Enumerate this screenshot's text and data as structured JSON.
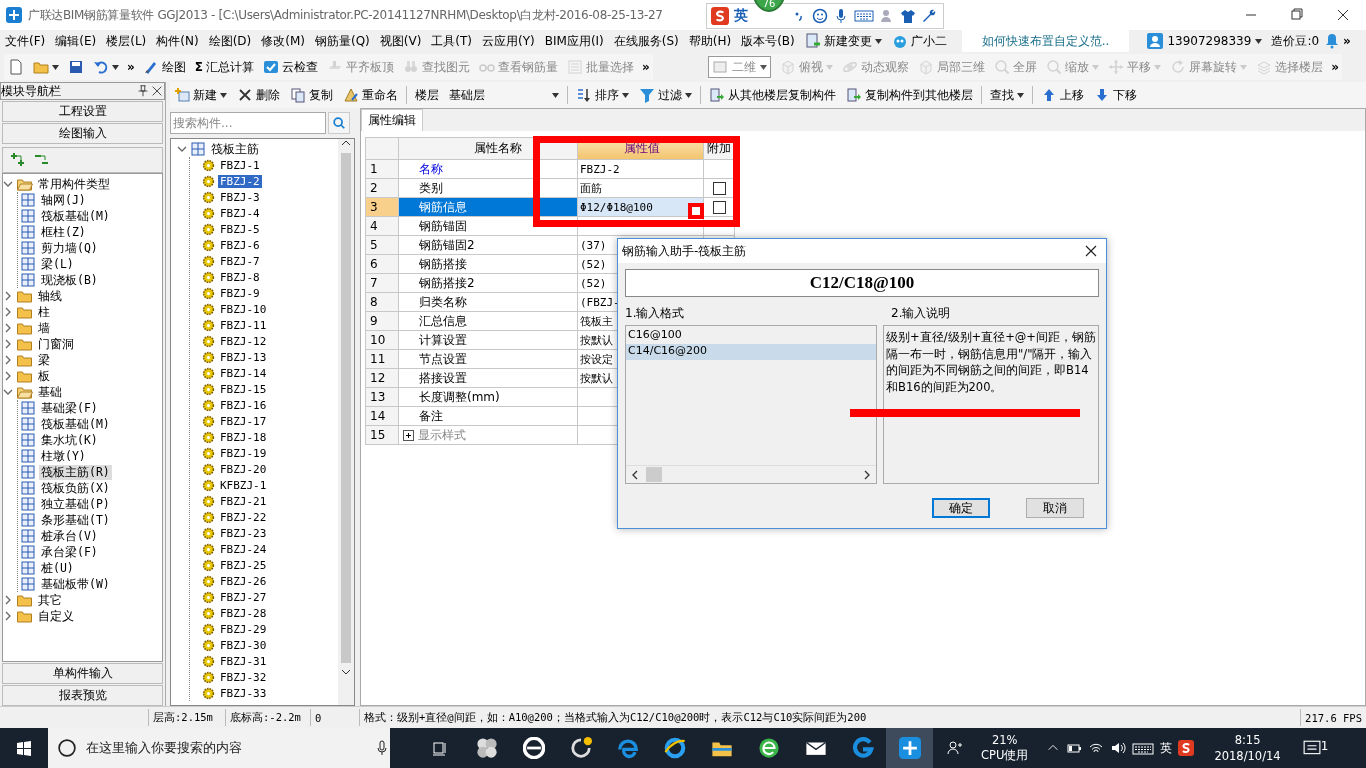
{
  "window": {
    "title": "广联达BIM钢筋算量软件 GGJ2013 - [C:\\Users\\Administrator.PC-20141127NRHM\\Desktop\\白龙村-2016-08-25-13-27"
  },
  "float_badge": {
    "text": "76"
  },
  "ime_bar": {
    "mode": "英"
  },
  "menu": [
    {
      "label": "文件(F)"
    },
    {
      "label": "编辑(E)"
    },
    {
      "label": "楼层(L)"
    },
    {
      "label": "构件(N)"
    },
    {
      "label": "绘图(D)"
    },
    {
      "label": "修改(M)"
    },
    {
      "label": "钢筋量(Q)"
    },
    {
      "label": "视图(V)"
    },
    {
      "label": "工具(T)"
    },
    {
      "label": "云应用(Y)"
    },
    {
      "label": "BIM应用(I)"
    },
    {
      "label": "在线服务(S)"
    },
    {
      "label": "帮助(H)"
    },
    {
      "label": "版本号(B)"
    }
  ],
  "menu_extras": {
    "change": {
      "label": "新建变更"
    },
    "assistant": {
      "label": "广小二"
    },
    "tip": {
      "text": "如何快速布置自定义范.."
    },
    "account": {
      "phone": "13907298339"
    },
    "beans": {
      "text": "造价豆:0"
    },
    "overflow": {
      "label": "»"
    }
  },
  "toolbars": [
    {
      "items": [
        {
          "kind": "icon",
          "dropdown": false,
          "disabled": false
        },
        {
          "kind": "icon",
          "dropdown": true,
          "disabled": false
        },
        {
          "kind": "icon",
          "dropdown": false,
          "disabled": false
        },
        {
          "kind": "icon",
          "dropdown": true,
          "disabled": false
        },
        {
          "kind": "overflow",
          "label": "»",
          "disabled": false
        },
        {
          "kind": "button",
          "label": "绘图",
          "dropdown": false,
          "disabled": false
        },
        {
          "kind": "button",
          "prefix": "Σ",
          "label": "汇总计算",
          "dropdown": false,
          "disabled": false
        },
        {
          "kind": "button",
          "label": "云检查",
          "dropdown": false,
          "disabled": false
        },
        {
          "kind": "button",
          "label": "平齐板顶",
          "dropdown": false,
          "disabled": true
        },
        {
          "kind": "button",
          "label": "查找图元",
          "dropdown": false,
          "disabled": true
        },
        {
          "kind": "button",
          "label": "查看钢筋量",
          "dropdown": false,
          "disabled": true
        },
        {
          "kind": "button",
          "label": "批量选择",
          "dropdown": false,
          "disabled": true
        },
        {
          "kind": "overflow",
          "label": "»",
          "disabled": false
        }
      ]
    },
    {
      "items": [
        {
          "kind": "combo",
          "label": "二维",
          "disabled": true
        },
        {
          "kind": "button",
          "label": "俯视",
          "dropdown": true,
          "disabled": true
        },
        {
          "kind": "button",
          "label": "动态观察",
          "dropdown": false,
          "disabled": true
        },
        {
          "kind": "button",
          "label": "局部三维",
          "dropdown": false,
          "disabled": true
        },
        {
          "kind": "button",
          "label": "全屏",
          "dropdown": false,
          "disabled": true
        },
        {
          "kind": "button",
          "label": "缩放",
          "dropdown": true,
          "disabled": true
        },
        {
          "kind": "button",
          "label": "平移",
          "dropdown": true,
          "disabled": true
        },
        {
          "kind": "button",
          "label": "屏幕旋转",
          "dropdown": true,
          "disabled": true
        },
        {
          "kind": "button",
          "label": "选择楼层",
          "dropdown": false,
          "disabled": true
        },
        {
          "kind": "overflow",
          "label": "»",
          "disabled": false
        }
      ]
    }
  ],
  "component_toolbar": [
    {
      "kind": "button",
      "label": "新建",
      "dropdown": true
    },
    {
      "kind": "button",
      "label": "删除",
      "dropdown": false
    },
    {
      "kind": "button",
      "label": "复制",
      "dropdown": false
    },
    {
      "kind": "button",
      "label": "重命名",
      "dropdown": false
    },
    {
      "kind": "label",
      "label": "楼层"
    },
    {
      "kind": "combo",
      "label": "基础层"
    },
    {
      "kind": "button",
      "label": "排序",
      "dropdown": true
    },
    {
      "kind": "button",
      "label": "过滤",
      "dropdown": true
    },
    {
      "kind": "button",
      "label": "从其他楼层复制构件",
      "dropdown": false
    },
    {
      "kind": "button",
      "label": "复制构件到其他楼层",
      "dropdown": false
    },
    {
      "kind": "text",
      "label": "查找",
      "dropdown": true
    },
    {
      "kind": "button",
      "label": "上移",
      "dropdown": false
    },
    {
      "kind": "button",
      "label": "下移",
      "dropdown": false
    }
  ],
  "nav": {
    "title": "模块导航栏",
    "top_buttons": [
      {
        "label": "工程设置"
      },
      {
        "label": "绘图输入"
      }
    ],
    "tree": [
      {
        "label": "常用构件类型",
        "expanded": true,
        "selected": false,
        "children": [
          {
            "label": "轴网(J)",
            "selected": false
          },
          {
            "label": "筏板基础(M)",
            "selected": false
          },
          {
            "label": "框柱(Z)",
            "selected": false
          },
          {
            "label": "剪力墙(Q)",
            "selected": false
          },
          {
            "label": "梁(L)",
            "selected": false
          },
          {
            "label": "现浇板(B)",
            "selected": false
          }
        ]
      },
      {
        "label": "轴线",
        "expanded": false,
        "selected": false
      },
      {
        "label": "柱",
        "expanded": false,
        "selected": false
      },
      {
        "label": "墙",
        "expanded": false,
        "selected": false
      },
      {
        "label": "门窗洞",
        "expanded": false,
        "selected": false
      },
      {
        "label": "梁",
        "expanded": false,
        "selected": false
      },
      {
        "label": "板",
        "expanded": false,
        "selected": false
      },
      {
        "label": "基础",
        "expanded": true,
        "selected": false,
        "children": [
          {
            "label": "基础梁(F)",
            "selected": false
          },
          {
            "label": "筏板基础(M)",
            "selected": false
          },
          {
            "label": "集水坑(K)",
            "selected": false
          },
          {
            "label": "柱墩(Y)",
            "selected": false
          },
          {
            "label": "筏板主筋(R)",
            "selected": true
          },
          {
            "label": "筏板负筋(X)",
            "selected": false
          },
          {
            "label": "独立基础(P)",
            "selected": false
          },
          {
            "label": "条形基础(T)",
            "selected": false
          },
          {
            "label": "桩承台(V)",
            "selected": false
          },
          {
            "label": "承台梁(F)",
            "selected": false
          },
          {
            "label": "桩(U)",
            "selected": false
          },
          {
            "label": "基础板带(W)",
            "selected": false
          }
        ]
      },
      {
        "label": "其它",
        "expanded": false,
        "selected": false
      },
      {
        "label": "自定义",
        "expanded": false,
        "selected": false
      }
    ],
    "bottom_buttons": [
      {
        "label": "单构件输入"
      },
      {
        "label": "报表预览"
      }
    ]
  },
  "components": {
    "search": {
      "placeholder": "搜索构件..."
    },
    "root": {
      "label": "筏板主筋",
      "expanded": true,
      "selected": false,
      "children": [
        {
          "label": "FBZJ-1",
          "selected": false
        },
        {
          "label": "FBZJ-2",
          "selected": true
        },
        {
          "label": "FBZJ-3",
          "selected": false
        },
        {
          "label": "FBZJ-4",
          "selected": false
        },
        {
          "label": "FBZJ-5",
          "selected": false
        },
        {
          "label": "FBZJ-6",
          "selected": false
        },
        {
          "label": "FBZJ-7",
          "selected": false
        },
        {
          "label": "FBZJ-8",
          "selected": false
        },
        {
          "label": "FBZJ-9",
          "selected": false
        },
        {
          "label": "FBZJ-10",
          "selected": false
        },
        {
          "label": "FBZJ-11",
          "selected": false
        },
        {
          "label": "FBZJ-12",
          "selected": false
        },
        {
          "label": "FBZJ-13",
          "selected": false
        },
        {
          "label": "FBZJ-14",
          "selected": false
        },
        {
          "label": "FBZJ-15",
          "selected": false
        },
        {
          "label": "FBZJ-16",
          "selected": false
        },
        {
          "label": "FBZJ-17",
          "selected": false
        },
        {
          "label": "FBZJ-18",
          "selected": false
        },
        {
          "label": "FBZJ-19",
          "selected": false
        },
        {
          "label": "FBZJ-20",
          "selected": false
        },
        {
          "label": "KFBZJ-1",
          "selected": false
        },
        {
          "label": "FBZJ-21",
          "selected": false
        },
        {
          "label": "FBZJ-22",
          "selected": false
        },
        {
          "label": "FBZJ-23",
          "selected": false
        },
        {
          "label": "FBZJ-24",
          "selected": false
        },
        {
          "label": "FBZJ-25",
          "selected": false
        },
        {
          "label": "FBZJ-26",
          "selected": false
        },
        {
          "label": "FBZJ-27",
          "selected": false
        },
        {
          "label": "FBZJ-28",
          "selected": false
        },
        {
          "label": "FBZJ-29",
          "selected": false
        },
        {
          "label": "FBZJ-30",
          "selected": false
        },
        {
          "label": "FBZJ-31",
          "selected": false
        },
        {
          "label": "FBZJ-32",
          "selected": false
        },
        {
          "label": "FBZJ-33",
          "selected": false
        }
      ]
    }
  },
  "properties": {
    "tab": {
      "label": "属性编辑",
      "selected": true
    },
    "columns": [
      "属性名称",
      "属性值",
      "附加"
    ],
    "rows": [
      {
        "num": "1",
        "name": "名称",
        "kind": "link",
        "value": "FBZJ-2",
        "selected": false
      },
      {
        "num": "2",
        "name": "类别",
        "kind": "normal",
        "value": "面筋",
        "selected": false,
        "checkbox": {
          "checked": false
        }
      },
      {
        "num": "3",
        "name": "钢筋信息",
        "kind": "normal",
        "value": "Φ12/Φ18@100",
        "selected": true,
        "checkbox": {
          "checked": false
        }
      },
      {
        "num": "4",
        "name": "钢筋锚固",
        "kind": "normal",
        "selected": false
      },
      {
        "num": "5",
        "name": "钢筋锚固2",
        "kind": "normal",
        "value": "(37)",
        "selected": false
      },
      {
        "num": "6",
        "name": "钢筋搭接",
        "kind": "normal",
        "value": "(52)",
        "selected": false
      },
      {
        "num": "7",
        "name": "钢筋搭接2",
        "kind": "normal",
        "value": "(52)",
        "selected": false
      },
      {
        "num": "8",
        "name": "归类名称",
        "kind": "normal",
        "value": "(FBZJ-",
        "selected": false
      },
      {
        "num": "9",
        "name": "汇总信息",
        "kind": "normal",
        "value": "筏板主",
        "selected": false
      },
      {
        "num": "10",
        "name": "计算设置",
        "kind": "normal",
        "value": "按默认",
        "selected": false
      },
      {
        "num": "11",
        "name": "节点设置",
        "kind": "normal",
        "value": "按设定",
        "selected": false
      },
      {
        "num": "12",
        "name": "搭接设置",
        "kind": "normal",
        "value": "按默认",
        "selected": false
      },
      {
        "num": "13",
        "name": "长度调整(mm)",
        "kind": "normal",
        "selected": false
      },
      {
        "num": "14",
        "name": "备注",
        "kind": "normal",
        "selected": false
      },
      {
        "num": "15",
        "name": "显示样式",
        "kind": "group",
        "expanded": false,
        "selected": false
      }
    ]
  },
  "dialog": {
    "title": "钢筋输入助手-筏板主筋",
    "value": "C12/C18@100",
    "format_label": "1.输入格式",
    "formats": [
      {
        "text": "C16@100",
        "selected": false
      },
      {
        "text": "C14/C16@200",
        "selected": true
      }
    ],
    "help_label": "2.输入说明",
    "help_text": "级别+直径/级别+直径+@+间距，钢筋隔一布一时，钢筋信息用\"/\"隔开，输入的间距为不同钢筋之间的间距，即B14和B16的间距为200。",
    "buttons": [
      {
        "label": "确定",
        "default": true
      },
      {
        "label": "取消",
        "default": false
      }
    ]
  },
  "status_bar": [
    "层高:2.15m",
    "底标高:-2.2m",
    "0",
    "格式：级别+直径@间距，如：A10@200；当格式输入为C12/C10@200时，表示C12与C10实际间距为200",
    "217.6 FPS"
  ],
  "taskbar": {
    "search": {
      "placeholder": "在这里输入你要搜索的内容"
    },
    "apps": [
      {
        "active": false
      },
      {
        "active": false
      },
      {
        "active": false
      },
      {
        "active": false
      },
      {
        "active": false
      },
      {
        "active": false
      },
      {
        "active": false
      },
      {
        "active": false
      },
      {
        "active": false
      },
      {
        "active": true
      }
    ],
    "cpu": {
      "percent": "21%",
      "label": "CPU使用"
    },
    "ime": "英",
    "time": "8:15",
    "date": "2018/10/14",
    "notifications": "1"
  }
}
